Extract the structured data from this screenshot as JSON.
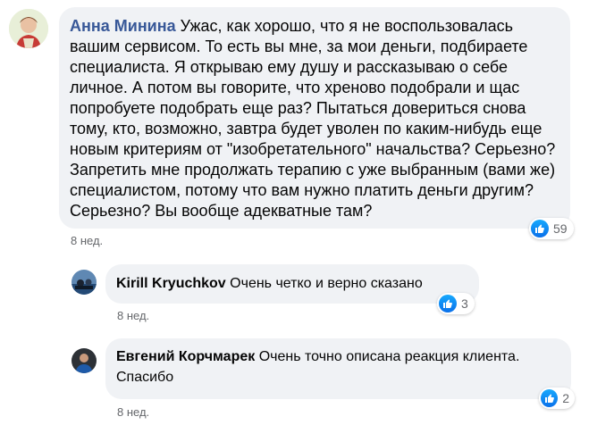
{
  "comments": [
    {
      "author": "Анна Минина",
      "text": "Ужас, как хорошо, что я не воспользовалась вашим сервисом. То есть вы мне, за мои деньги, подбираете специалиста. Я открываю ему душу и рассказываю о себе личное. А потом вы говорите, что хреново подобрали и щас попробуете подобрать еще раз? Пытаться довериться снова тому, кто, возможно, завтра будет уволен по каким-нибудь еще новым критериям от \"изобретательного\" начальства? Серьезно? Запретить мне продолжать терапию с уже выбранным (вами же) специалистом, потому что вам нужно платить деньги другим? Серьезно? Вы вообще адекватные там?",
      "time": "8 нед.",
      "likes": "59"
    },
    {
      "author": "Kirill Kryuchkov",
      "text": "Очень четко и верно сказано",
      "time": "8 нед.",
      "likes": "3"
    },
    {
      "author": "Евгений Корчмарек",
      "text": "Очень точно описана реакция клиента. Спасибо",
      "time": "8 нед.",
      "likes": "2"
    }
  ],
  "colors": {
    "bubble": "#f0f2f5",
    "author_link": "#385898",
    "like_blue": "#0a70ea",
    "meta_gray": "#65676b"
  },
  "icons": {
    "like": "thumbs-up-icon"
  }
}
